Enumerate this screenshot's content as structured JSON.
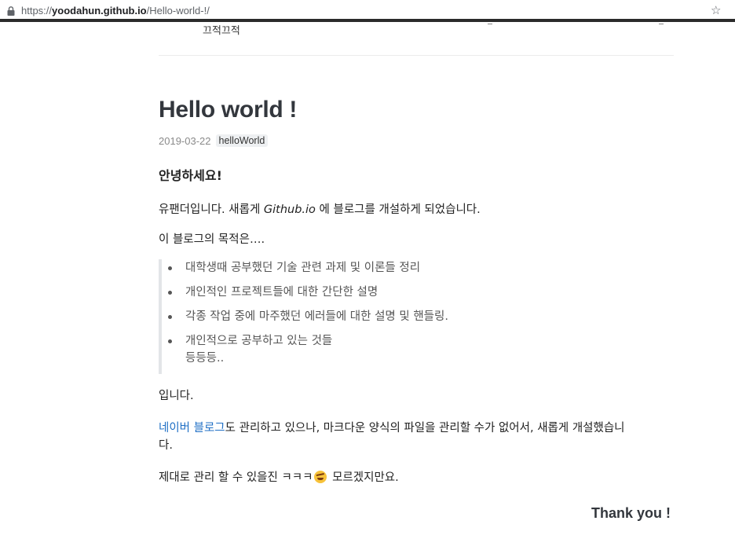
{
  "browser": {
    "url_scheme": "https://",
    "url_host": "yoodahun.github.io",
    "url_path": "/Hello-world-!/",
    "icons": {
      "lock": "lock-icon",
      "star": "star-icon"
    }
  },
  "header": {
    "snippet": "끄적끄적"
  },
  "post": {
    "title": "Hello world !",
    "date": "2019-03-22",
    "tag": "helloWorld",
    "greeting": "안녕하세요!",
    "intro_before": "유팬더입니다. 새롭게 ",
    "intro_em": "Github.io",
    "intro_after": " 에 블로그를 개설하게 되었습니다.",
    "purpose": "이 블로그의 목적은….",
    "goals": [
      "대학생때 공부했던 기술 관련 과제 및 이론들 정리",
      "개인적인 프로젝트들에 대한 간단한 설명",
      "각종 작업 중에 마주했던 에러들에 대한 설명 및 핸들링.",
      "개인적으로 공부하고 있는 것들"
    ],
    "goals_extra": "등등등..",
    "conclusion": "입니다.",
    "naver_link": "네이버 블로그",
    "naver_text_1": "도 관리하고 있으나, 마크다운 양식의 파일을 관리할 수가 없어서, 새롭게 개설했습니",
    "naver_text_2": "다.",
    "closing_before": "제대로 관리 할 수 있을진 ㅋㅋㅋ",
    "closing_after": " 모르겠지만요.",
    "emoji": "rofl-emoji-icon",
    "thanks": "Thank you !"
  },
  "colors": {
    "link": "#1f6fc5",
    "title": "#33373d",
    "quote_border": "#e3e5e8",
    "tag_bg": "#eef0f2"
  }
}
